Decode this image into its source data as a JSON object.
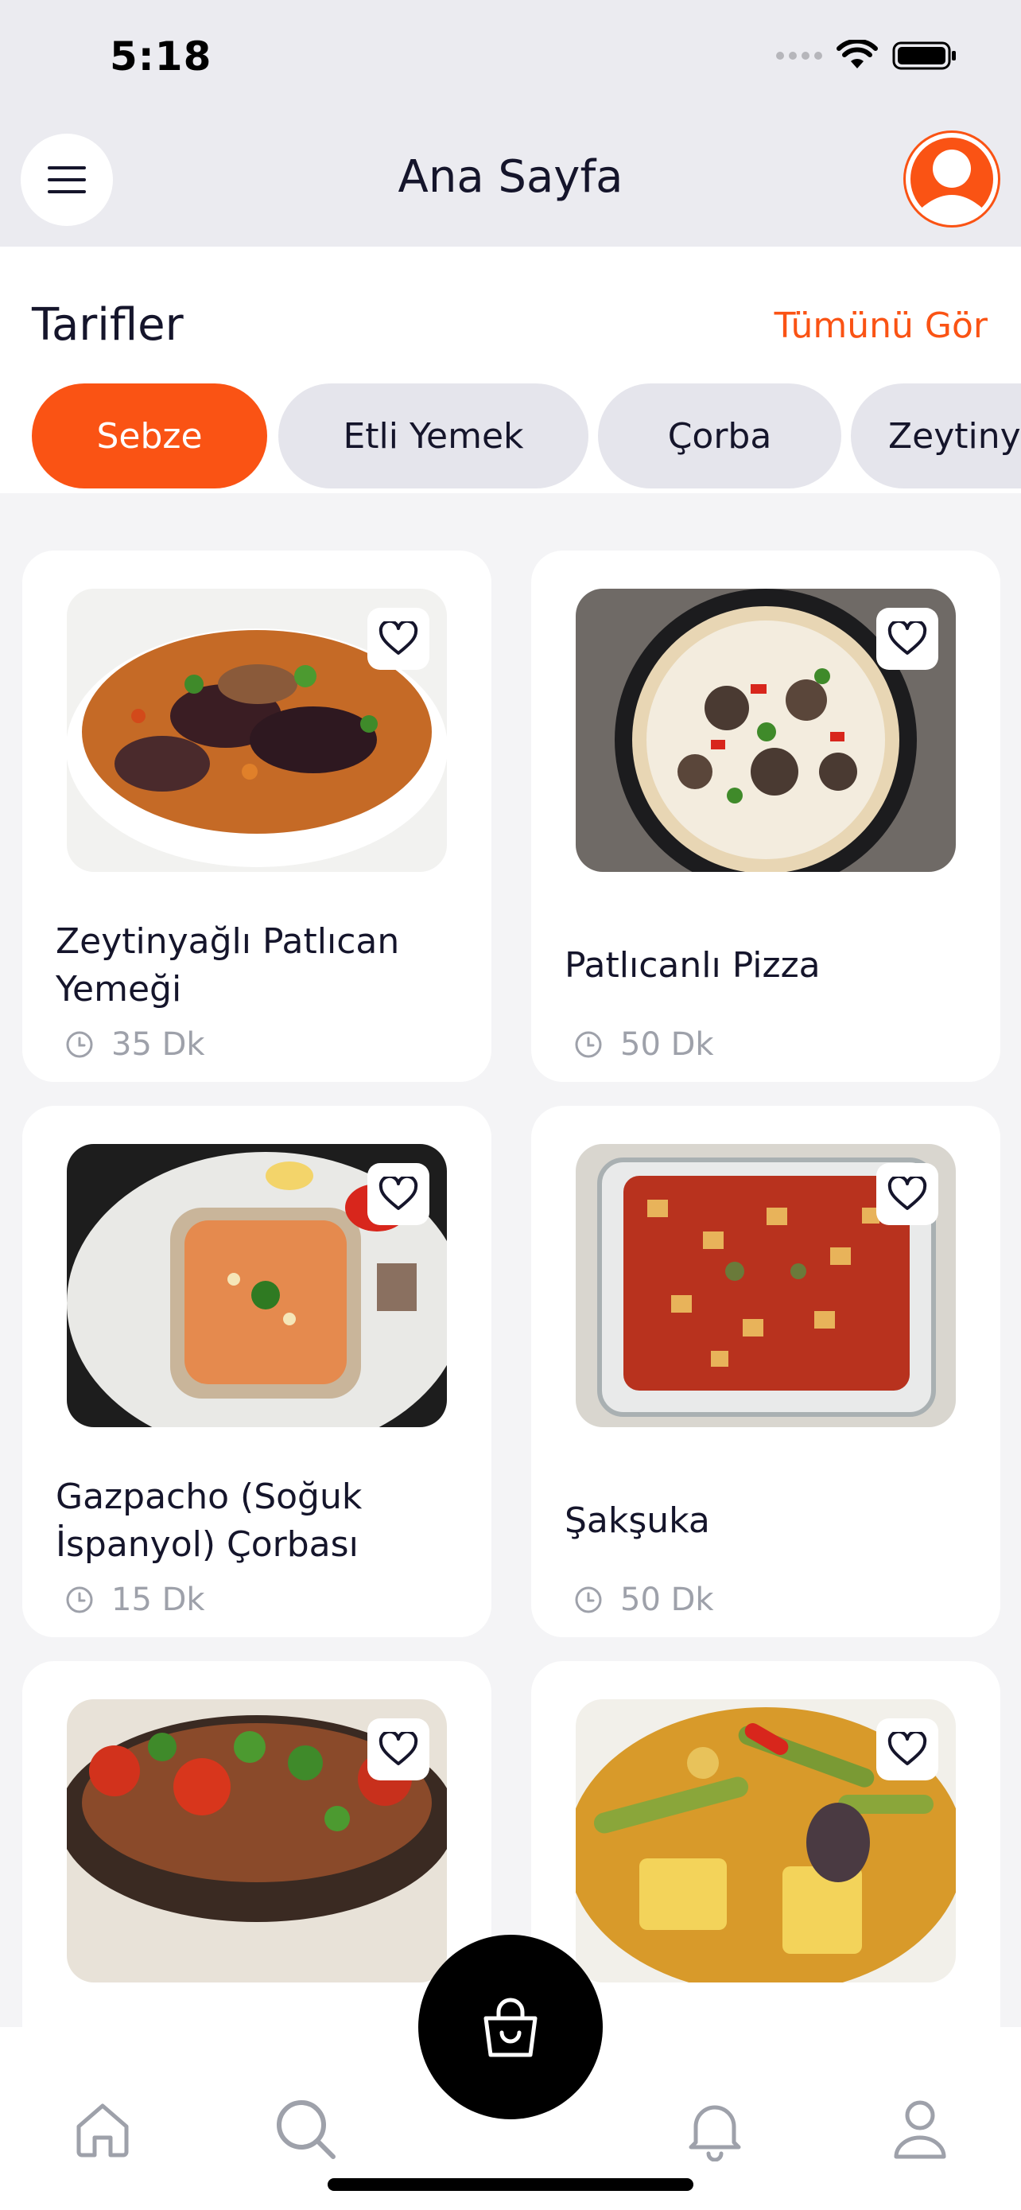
{
  "status_bar": {
    "time": "5:18"
  },
  "header": {
    "title": "Ana Sayfa"
  },
  "section": {
    "title": "Tarifler",
    "see_all": "Tümünü Gör"
  },
  "categories": [
    {
      "label": "Sebze",
      "active": true
    },
    {
      "label": "Etli Yemek",
      "active": false
    },
    {
      "label": "Çorba",
      "active": false
    },
    {
      "label": "Zeytinyağlı",
      "active": false
    }
  ],
  "recipes": [
    {
      "name": "Zeytinyağlı Patlıcan Yemeği",
      "time": "35 Dk",
      "favorite": false
    },
    {
      "name": "Patlıcanlı Pizza",
      "time": "50 Dk",
      "favorite": false
    },
    {
      "name": "Gazpacho (Soğuk İspanyol) Çorbası",
      "time": "15 Dk",
      "favorite": false
    },
    {
      "name": "Şakşuka",
      "time": "50 Dk",
      "favorite": false
    },
    {
      "name": "",
      "time": "",
      "favorite": false
    },
    {
      "name": "",
      "time": "",
      "favorite": false
    }
  ],
  "tabbar": {
    "items": [
      "home-icon",
      "search-icon",
      "cart-icon",
      "bell-icon",
      "profile-icon"
    ]
  },
  "colors": {
    "accent": "#FA5314",
    "text": "#15152B",
    "muted": "#9EA1AA",
    "chip": "#E5E5EC"
  }
}
